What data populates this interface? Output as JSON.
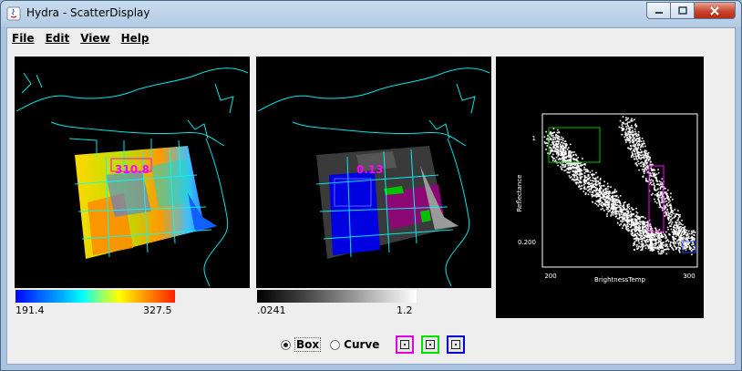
{
  "window": {
    "title": "Hydra - ScatterDisplay"
  },
  "menu": [
    "File",
    "Edit",
    "View",
    "Help"
  ],
  "left_image": {
    "overlay_label": "310.8",
    "colorbar": {
      "min_label": "191.4",
      "max_label": "327.5"
    }
  },
  "middle_image": {
    "overlay_label": "0.13",
    "colorbar": {
      "min_label": ".0241",
      "max_label": "1.2"
    }
  },
  "scatter": {
    "ylabel": "Reflectance",
    "xlabel": "BrightnessTemp",
    "ytick_top": "1",
    "ytick_bottom": "0.200",
    "xtick_left": "200",
    "xtick_right": "300"
  },
  "controls": {
    "box_label": "Box",
    "curve_label": "Curve",
    "selected_mode": "Box",
    "selector_colors": [
      "#e000e0",
      "#00e000",
      "#0000d0"
    ]
  }
}
